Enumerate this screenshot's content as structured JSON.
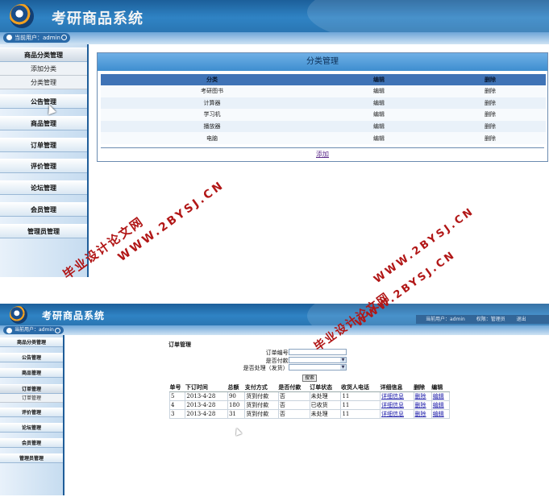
{
  "screen1": {
    "app_title": "考研商品系统",
    "user_label": "当前用户：admin",
    "sidebar": [
      {
        "label": "商品分类管理",
        "open": true,
        "children": [
          "添加分类",
          "分类管理"
        ]
      },
      {
        "label": "公告管理"
      },
      {
        "label": "商品管理"
      },
      {
        "label": "订单管理"
      },
      {
        "label": "评价管理"
      },
      {
        "label": "论坛管理"
      },
      {
        "label": "会员管理"
      },
      {
        "label": "管理员管理"
      }
    ],
    "panel_title": "分类管理",
    "table_headers": [
      "分类",
      "编辑",
      "删除"
    ],
    "rows": [
      {
        "name": "考研图书",
        "edit": "编辑",
        "delete": "删除"
      },
      {
        "name": "计算器",
        "edit": "编辑",
        "delete": "删除"
      },
      {
        "name": "学习机",
        "edit": "编辑",
        "delete": "删除"
      },
      {
        "name": "播放器",
        "edit": "编辑",
        "delete": "删除"
      },
      {
        "name": "电脑",
        "edit": "编辑",
        "delete": "删除"
      }
    ],
    "add_link": "添加"
  },
  "screen2": {
    "app_title": "考研商品系统",
    "user_label": "当前用户：admin",
    "header_right": {
      "user": "当前用户：admin",
      "role": "权限：管理员",
      "exit": "退出"
    },
    "sidebar": [
      {
        "label": "商品分类管理"
      },
      {
        "label": "公告管理"
      },
      {
        "label": "商品管理"
      },
      {
        "label": "订单管理",
        "open": true,
        "children": [
          "订单管理"
        ]
      },
      {
        "label": "评价管理"
      },
      {
        "label": "论坛管理"
      },
      {
        "label": "会员管理"
      },
      {
        "label": "管理员管理"
      }
    ],
    "page_title": "订单管理",
    "search": {
      "order_no_label": "订单编号:",
      "paid_label": "是否付款:",
      "processed_label": "是否处理（发货）:",
      "button": "搜索"
    },
    "table_headers": [
      "单号",
      "下订时间",
      "总额",
      "支付方式",
      "是否付款",
      "订单状态",
      "收货人电话",
      "详细信息",
      "删除",
      "编辑"
    ],
    "rows": [
      [
        "5",
        "2013-4-28",
        "90",
        "货到付款",
        "否",
        "未处理",
        "11",
        "详细信息",
        "删除",
        "编辑"
      ],
      [
        "4",
        "2013-4-28",
        "180",
        "货到付款",
        "否",
        "已收货",
        "11",
        "详细信息",
        "删除",
        "编辑"
      ],
      [
        "3",
        "2013-4-28",
        "31",
        "货到付款",
        "否",
        "未处理",
        "11",
        "详细信息",
        "删除",
        "编辑"
      ]
    ]
  },
  "watermarks": {
    "site_name": "毕业设计论文网",
    "site_url": "WWW.2BYSJ.CN"
  },
  "colors": {
    "header_blue": "#2f83c4",
    "table_header": "#3f73b6",
    "watermark": "#b11616"
  }
}
